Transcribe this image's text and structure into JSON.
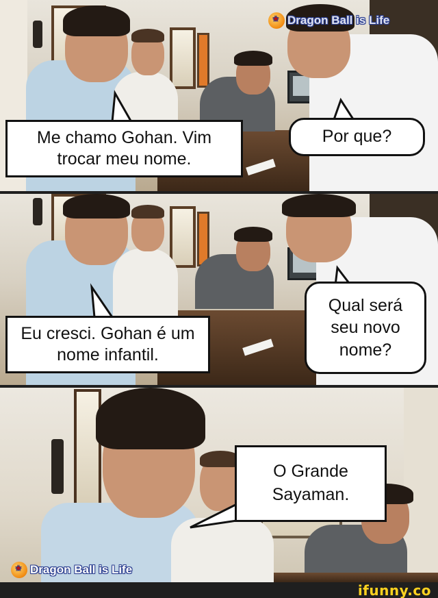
{
  "watermark": {
    "text": "Dragon Ball is Life",
    "icon": "dragon-ball-icon"
  },
  "panels": [
    {
      "bubbles": [
        {
          "text": "Me chamo Gohan. Vim trocar meu nome."
        },
        {
          "text": "Por que?"
        }
      ]
    },
    {
      "bubbles": [
        {
          "text": "Eu cresci. Gohan é um nome infantil."
        },
        {
          "text": "Qual será seu novo nome?"
        }
      ]
    },
    {
      "bubbles": [
        {
          "text": "O Grande Sayaman."
        }
      ]
    }
  ],
  "footer": {
    "brand": "ifunny.co",
    "brand_color": "#ffd21f"
  }
}
